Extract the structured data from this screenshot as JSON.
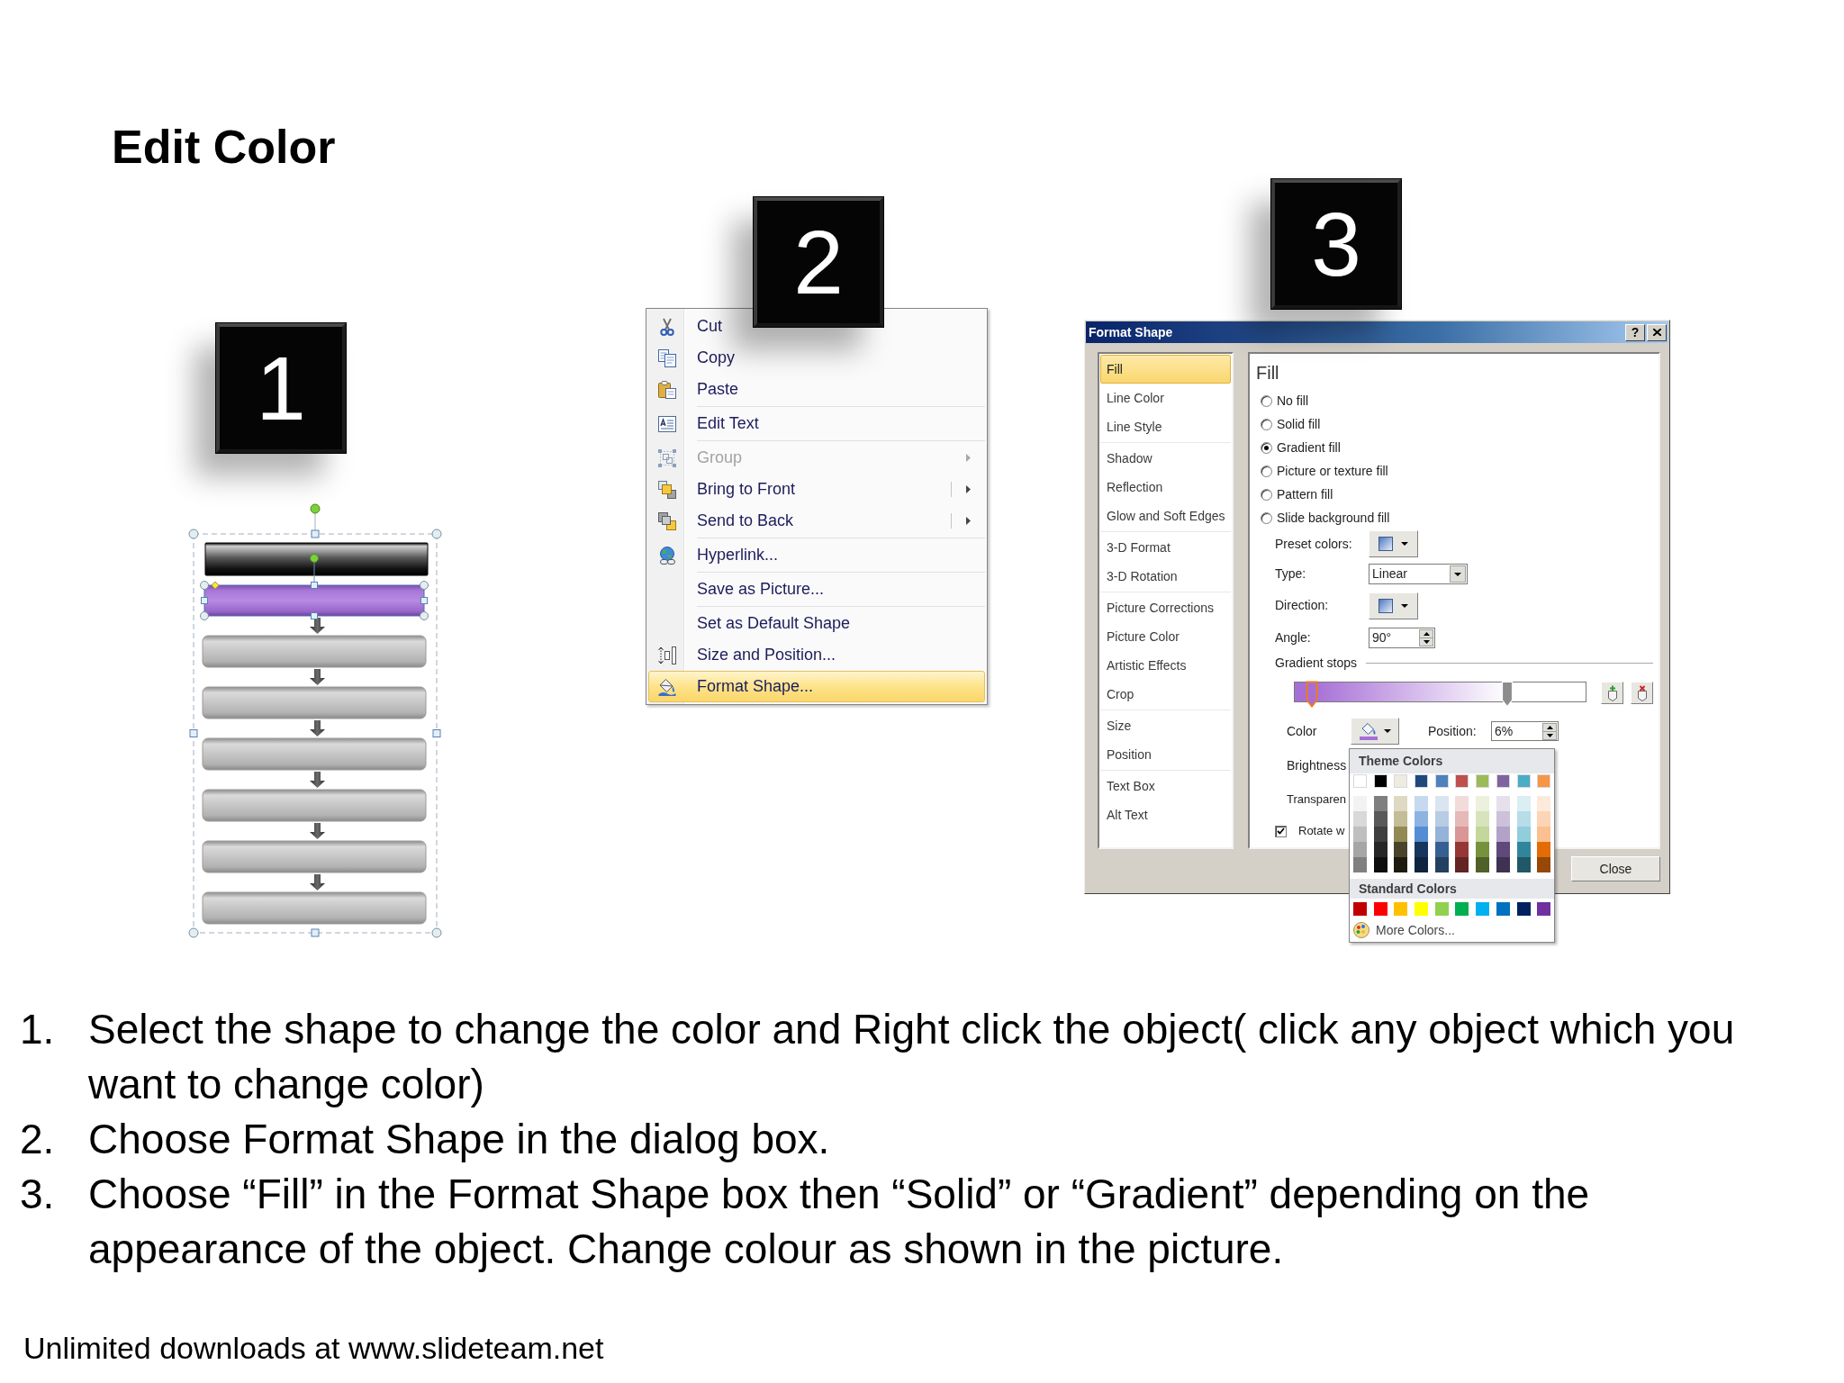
{
  "title": "Edit Color",
  "step_1": {
    "badge": "1",
    "diagram": {
      "bars": [
        {
          "kind": "dark",
          "selected": false
        },
        {
          "kind": "highlighted",
          "selected": true
        },
        {
          "kind": "plain",
          "selected": false
        },
        {
          "kind": "plain",
          "selected": false
        },
        {
          "kind": "plain",
          "selected": false
        },
        {
          "kind": "plain",
          "selected": false
        },
        {
          "kind": "plain",
          "selected": false
        },
        {
          "kind": "plain",
          "selected": false
        }
      ]
    }
  },
  "step_2": {
    "badge": "2",
    "context_menu": {
      "groups": [
        [
          {
            "label": "Cut",
            "kind": "plain",
            "disabled": false,
            "selected": false
          },
          {
            "label": "Copy",
            "kind": "plain",
            "disabled": false,
            "selected": false
          },
          {
            "label": "Paste",
            "kind": "plain",
            "disabled": false,
            "selected": false
          }
        ],
        [
          {
            "label": "Edit Text",
            "kind": "plain",
            "disabled": false,
            "selected": false
          }
        ],
        [
          {
            "label": "Group",
            "kind": "submenu",
            "disabled": true,
            "selected": false
          },
          {
            "label": "Bring to Front",
            "kind": "split",
            "disabled": false,
            "selected": false
          },
          {
            "label": "Send to Back",
            "kind": "split",
            "disabled": false,
            "selected": false
          }
        ],
        [
          {
            "label": "Hyperlink...",
            "kind": "plain",
            "disabled": false,
            "selected": false
          }
        ],
        [
          {
            "label": "Save as Picture...",
            "kind": "plain",
            "disabled": false,
            "selected": false
          }
        ],
        [
          {
            "label": "Set as Default Shape",
            "kind": "plain",
            "disabled": false,
            "selected": false
          },
          {
            "label": "Size and Position...",
            "kind": "plain",
            "disabled": false,
            "selected": false
          },
          {
            "label": "Format Shape...",
            "kind": "plain",
            "disabled": false,
            "selected": true
          }
        ]
      ]
    }
  },
  "step_3": {
    "badge": "3",
    "dialog": {
      "title": "Format Shape",
      "help": "?",
      "nav_groups": [
        [
          {
            "label": "Fill",
            "selected": true
          },
          {
            "label": "Line Color",
            "selected": false
          },
          {
            "label": "Line Style",
            "selected": false
          }
        ],
        [
          {
            "label": "Shadow",
            "selected": false
          },
          {
            "label": "Reflection",
            "selected": false
          },
          {
            "label": "Glow and Soft Edges",
            "selected": false
          }
        ],
        [
          {
            "label": "3-D Format",
            "selected": false
          },
          {
            "label": "3-D Rotation",
            "selected": false
          }
        ],
        [
          {
            "label": "Picture Corrections",
            "selected": false
          },
          {
            "label": "Picture Color",
            "selected": false
          },
          {
            "label": "Artistic Effects",
            "selected": false
          },
          {
            "label": "Crop",
            "selected": false
          }
        ],
        [
          {
            "label": "Size",
            "selected": false
          },
          {
            "label": "Position",
            "selected": false
          }
        ],
        [
          {
            "label": "Text Box",
            "selected": false
          },
          {
            "label": "Alt Text",
            "selected": false
          }
        ]
      ],
      "panel": {
        "heading": "Fill",
        "fill_options": [
          {
            "label": "No fill",
            "selected": false
          },
          {
            "label": "Solid fill",
            "selected": false
          },
          {
            "label": "Gradient fill",
            "selected": true
          },
          {
            "label": "Picture or texture fill",
            "selected": false
          },
          {
            "label": "Pattern fill",
            "selected": false
          },
          {
            "label": "Slide background fill",
            "selected": false
          }
        ],
        "preset_colors": {
          "label": "Preset colors:"
        },
        "type": {
          "label": "Type:",
          "value": "Linear"
        },
        "direction": {
          "label": "Direction:"
        },
        "angle": {
          "label": "Angle:",
          "value": "90°"
        },
        "gradient_stops": {
          "label": "Gradient stops",
          "stops": [
            {
              "level": 0.06,
              "selected": true
            },
            {
              "level": 0.73,
              "selected": false
            }
          ]
        },
        "color": {
          "label": "Color",
          "color": "#a66fd6"
        },
        "position": {
          "label": "Position:",
          "value": "6%"
        },
        "brightness": {
          "label": "Brightness"
        },
        "transparency": {
          "label": "Transparen"
        },
        "rotate_with_shape": {
          "label": "Rotate w",
          "checked": true
        }
      },
      "close_button": "Close",
      "color_menu": {
        "theme_heading": "Theme Colors",
        "theme_colors": [
          {
            "color": "#ffffff",
            "shades": [
              {
                "color": "#f2f2f2"
              },
              {
                "color": "#d9d9d9"
              },
              {
                "color": "#bfbfbf"
              },
              {
                "color": "#a6a6a6"
              },
              {
                "color": "#808080"
              }
            ]
          },
          {
            "color": "#000000",
            "shades": [
              {
                "color": "#7f7f7f"
              },
              {
                "color": "#595959"
              },
              {
                "color": "#3f3f3f"
              },
              {
                "color": "#262626"
              },
              {
                "color": "#0d0d0d"
              }
            ]
          },
          {
            "color": "#eeece1",
            "shades": [
              {
                "color": "#ddd9c3"
              },
              {
                "color": "#c4bd97"
              },
              {
                "color": "#938953"
              },
              {
                "color": "#494429"
              },
              {
                "color": "#1d1b10"
              }
            ]
          },
          {
            "color": "#1f497d",
            "shades": [
              {
                "color": "#c6d9f0"
              },
              {
                "color": "#8db3e2"
              },
              {
                "color": "#548dd4"
              },
              {
                "color": "#17365d"
              },
              {
                "color": "#0f243e"
              }
            ]
          },
          {
            "color": "#4f81bd",
            "shades": [
              {
                "color": "#dbe5f1"
              },
              {
                "color": "#b8cce4"
              },
              {
                "color": "#95b3d7"
              },
              {
                "color": "#366092"
              },
              {
                "color": "#244061"
              }
            ]
          },
          {
            "color": "#c0504d",
            "shades": [
              {
                "color": "#f2dcdb"
              },
              {
                "color": "#e5b9b7"
              },
              {
                "color": "#d99694"
              },
              {
                "color": "#953734"
              },
              {
                "color": "#632423"
              }
            ]
          },
          {
            "color": "#9bbb59",
            "shades": [
              {
                "color": "#ebf1dd"
              },
              {
                "color": "#d7e3bc"
              },
              {
                "color": "#c3d69b"
              },
              {
                "color": "#76923c"
              },
              {
                "color": "#4f6128"
              }
            ]
          },
          {
            "color": "#8064a2",
            "shades": [
              {
                "color": "#e5e0ec"
              },
              {
                "color": "#ccc1d9"
              },
              {
                "color": "#b2a2c7"
              },
              {
                "color": "#5f497a"
              },
              {
                "color": "#3f3151"
              }
            ]
          },
          {
            "color": "#4bacc6",
            "shades": [
              {
                "color": "#dbeef3"
              },
              {
                "color": "#b7dde8"
              },
              {
                "color": "#92cddc"
              },
              {
                "color": "#31859b"
              },
              {
                "color": "#205867"
              }
            ]
          },
          {
            "color": "#f79646",
            "shades": [
              {
                "color": "#fdeada"
              },
              {
                "color": "#fbd5b5"
              },
              {
                "color": "#fac08f"
              },
              {
                "color": "#e36c09"
              },
              {
                "color": "#974806"
              }
            ]
          }
        ],
        "standard_heading": "Standard Colors",
        "standard_colors": [
          {
            "color": "#c00000"
          },
          {
            "color": "#ff0000"
          },
          {
            "color": "#ffc000"
          },
          {
            "color": "#ffff00"
          },
          {
            "color": "#92d050"
          },
          {
            "color": "#00b050"
          },
          {
            "color": "#00b0f0"
          },
          {
            "color": "#0070c0"
          },
          {
            "color": "#002060"
          },
          {
            "color": "#7030a0"
          }
        ],
        "more_colors": "More Colors..."
      }
    }
  },
  "instructions": [
    {
      "number": "1.",
      "text": "Select the shape to change the color and Right click the object( click any object which you want to change color)"
    },
    {
      "number": "2.",
      "text": "Choose Format Shape in the dialog box."
    },
    {
      "number": "3.",
      "text": "Choose “Fill” in the Format Shape box then “Solid” or “Gradient” depending on the appearance of the object. Change colour as shown in the picture."
    }
  ],
  "footer": "Unlimited downloads at www.slideteam.net"
}
